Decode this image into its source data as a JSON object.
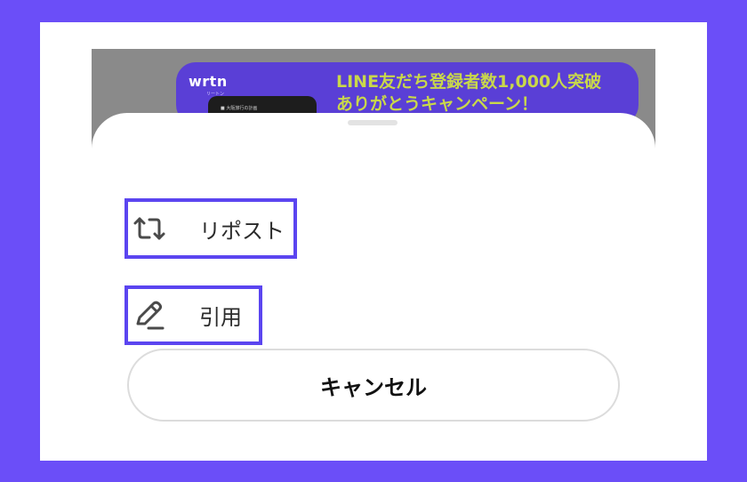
{
  "colors": {
    "background": "#6b4ef8",
    "highlight_border": "#5b45f0",
    "banner_bg": "#5a3fd6",
    "banner_title": "#c9d84a"
  },
  "background_banner": {
    "logo": "wrtn",
    "logo_sub": "リートン",
    "phone_text": "■ 大阪旅行の計画",
    "title": "LINE友だち登録者数1,000人突破\nありがとうキャンペーン！"
  },
  "sheet": {
    "items": [
      {
        "label": "リポスト",
        "icon": "repost-icon"
      },
      {
        "label": "引用",
        "icon": "quote-pencil-icon"
      }
    ],
    "cancel_label": "キャンセル"
  }
}
